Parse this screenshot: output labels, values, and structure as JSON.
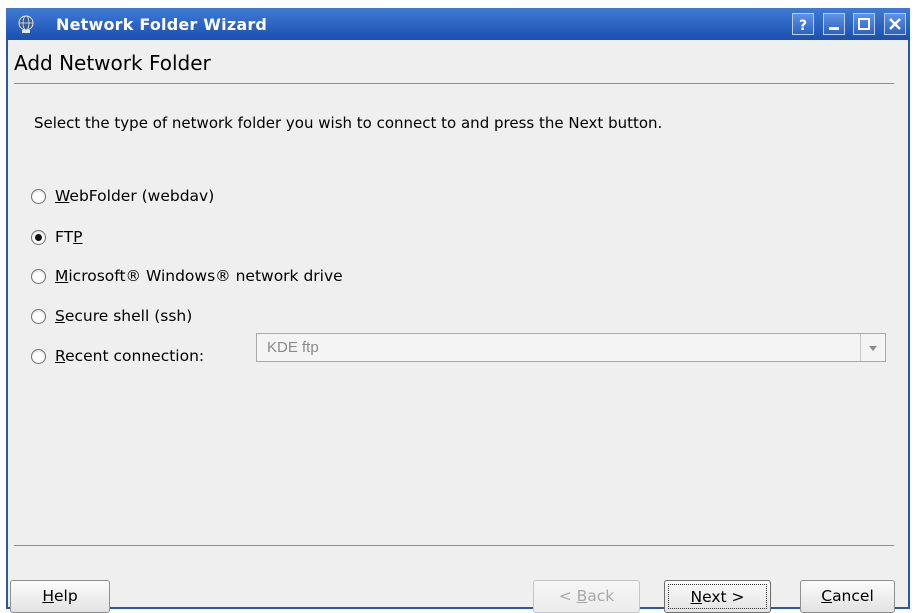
{
  "window": {
    "title": "Network Folder Wizard",
    "icons": {
      "app": "network-globe-icon",
      "help": "help-icon",
      "minimize": "minimize-icon",
      "maximize": "maximize-icon",
      "close": "close-icon"
    },
    "titlebar_color": "#2b63c3"
  },
  "page": {
    "title": "Add Network Folder",
    "instruction": "Select the type of network folder you wish to connect to and press the Next button."
  },
  "options": [
    {
      "mnemonic": "W",
      "rest": "ebFolder (webdav)",
      "checked": false
    },
    {
      "pre": "FT",
      "mnemonic": "P",
      "checked": true
    },
    {
      "mnemonic": "M",
      "rest": "icrosoft® Windows® network drive",
      "checked": false
    },
    {
      "mnemonic": "S",
      "rest": "ecure shell (ssh)",
      "checked": false
    },
    {
      "mnemonic": "R",
      "rest": "ecent connection:",
      "checked": false
    }
  ],
  "recent_combo": {
    "value": "KDE ftp",
    "enabled": false
  },
  "buttons": {
    "help": {
      "mnemonic": "H",
      "rest": "elp"
    },
    "back": {
      "pre": "< ",
      "mnemonic": "B",
      "rest": "ack",
      "enabled": false
    },
    "next": {
      "mnemonic": "N",
      "rest": "ext >"
    },
    "cancel": {
      "mnemonic": "C",
      "rest": "ancel"
    }
  }
}
